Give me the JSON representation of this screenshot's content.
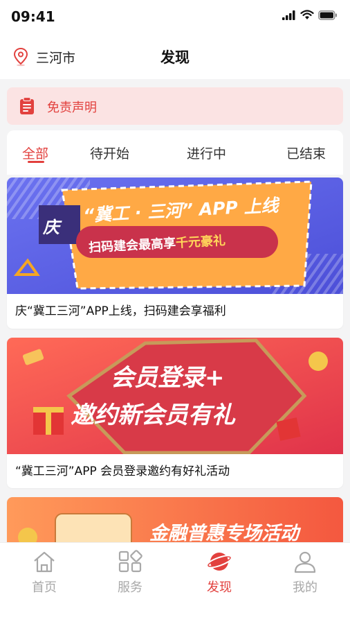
{
  "status_bar": {
    "time": "09:41"
  },
  "header": {
    "city": "三河市",
    "title": "发现"
  },
  "disclaimer": {
    "label": "免责声明"
  },
  "tabs": [
    {
      "label": "全部",
      "active": true
    },
    {
      "label": "待开始",
      "active": false
    },
    {
      "label": "进行中",
      "active": false
    },
    {
      "label": "已结束",
      "active": false
    }
  ],
  "cards": [
    {
      "banner_title_1": "庆",
      "banner_title_2": "“冀工 · 三河” APP 上线",
      "banner_pill_1": "扫码建会最高享",
      "banner_pill_2": "千元豪礼",
      "caption": "庆“冀工三河”APP上线，扫码建会享福利"
    },
    {
      "banner_line_1": "会员登录+",
      "banner_line_2": "邀约新会员有礼",
      "caption": "“冀工三河”APP 会员登录邀约有好礼活动"
    },
    {
      "banner_line_1": "金融普惠专场活动"
    }
  ],
  "bottom_nav": [
    {
      "label": "首页",
      "icon": "home-icon",
      "active": false
    },
    {
      "label": "服务",
      "icon": "services-icon",
      "active": false
    },
    {
      "label": "发现",
      "icon": "discover-icon",
      "active": true
    },
    {
      "label": "我的",
      "icon": "profile-icon",
      "active": false
    }
  ],
  "colors": {
    "accent": "#e2413e",
    "inactive": "#a8a8a8",
    "disclaimer_bg": "#fbe3e3"
  }
}
